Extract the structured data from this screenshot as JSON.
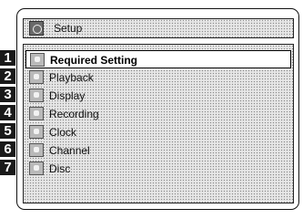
{
  "title": {
    "label": "Setup",
    "icon": "setup-icon"
  },
  "menu": {
    "selected_index": 0,
    "items": [
      {
        "number": "1",
        "label": "Required Setting",
        "icon": "required-setting-icon"
      },
      {
        "number": "2",
        "label": "Playback",
        "icon": "playback-icon"
      },
      {
        "number": "3",
        "label": "Display",
        "icon": "display-icon"
      },
      {
        "number": "4",
        "label": "Recording",
        "icon": "recording-icon"
      },
      {
        "number": "5",
        "label": "Clock",
        "icon": "clock-icon"
      },
      {
        "number": "6",
        "label": "Channel",
        "icon": "channel-icon"
      },
      {
        "number": "7",
        "label": "Disc",
        "icon": "disc-icon"
      }
    ]
  }
}
